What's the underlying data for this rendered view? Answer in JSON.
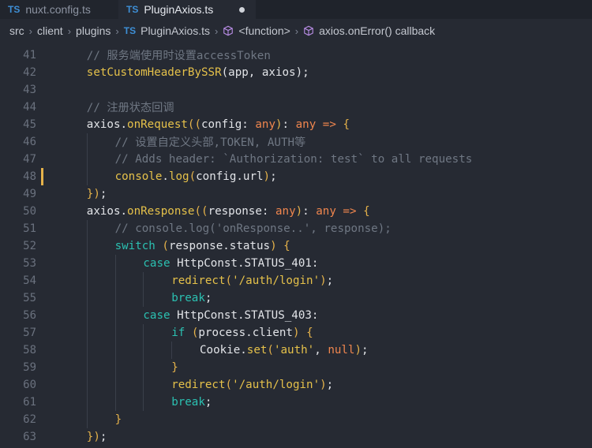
{
  "tabs": [
    {
      "badge": "TS",
      "label": "nuxt.config.ts",
      "active": false
    },
    {
      "badge": "TS",
      "label": "PluginAxios.ts",
      "active": true
    }
  ],
  "breadcrumb": {
    "items": [
      "src",
      "client",
      "plugins"
    ],
    "file_badge": "TS",
    "file": "PluginAxios.ts",
    "symbol1": "<function>",
    "symbol2": "axios.onError() callback"
  },
  "lines": [
    {
      "n": "41",
      "indent": 1,
      "tokens": [
        [
          "cm",
          "// 服务端使用时设置accessToken"
        ]
      ]
    },
    {
      "n": "42",
      "indent": 1,
      "tokens": [
        [
          "fn",
          "setCustomHeaderBySSR"
        ],
        [
          "pr",
          "(app, axios);"
        ]
      ]
    },
    {
      "n": "43",
      "indent": 0,
      "tokens": []
    },
    {
      "n": "44",
      "indent": 1,
      "tokens": [
        [
          "cm",
          "// 注册状态回调"
        ]
      ]
    },
    {
      "n": "45",
      "indent": 1,
      "tokens": [
        [
          "obj",
          "axios."
        ],
        [
          "fn",
          "onRequest"
        ],
        [
          "brk",
          "(("
        ],
        [
          "pr",
          "config: "
        ],
        [
          "typ",
          "any"
        ],
        [
          "brk",
          ")"
        ],
        [
          "pr",
          ": "
        ],
        [
          "typ",
          "any"
        ],
        [
          "pr",
          " "
        ],
        [
          "kw",
          "=>"
        ],
        [
          "pr",
          " "
        ],
        [
          "brk",
          "{"
        ]
      ]
    },
    {
      "n": "46",
      "indent": 2,
      "tokens": [
        [
          "cm",
          "// 设置自定义头部,TOKEN, AUTH等"
        ]
      ]
    },
    {
      "n": "47",
      "indent": 2,
      "tokens": [
        [
          "cm",
          "// Adds header: `Authorization: test` to all requests"
        ]
      ]
    },
    {
      "n": "48",
      "indent": 2,
      "tokens": [
        [
          "fn",
          "console"
        ],
        [
          "pr",
          "."
        ],
        [
          "fn",
          "log"
        ],
        [
          "brk",
          "("
        ],
        [
          "pr",
          "config.url"
        ],
        [
          "brk",
          ")"
        ],
        [
          "pr",
          ";"
        ]
      ]
    },
    {
      "n": "49",
      "indent": 1,
      "tokens": [
        [
          "brk",
          "})"
        ],
        [
          "pr",
          ";"
        ]
      ]
    },
    {
      "n": "50",
      "indent": 1,
      "tokens": [
        [
          "obj",
          "axios."
        ],
        [
          "fn",
          "onResponse"
        ],
        [
          "brk",
          "(("
        ],
        [
          "pr",
          "response: "
        ],
        [
          "typ",
          "any"
        ],
        [
          "brk",
          ")"
        ],
        [
          "pr",
          ": "
        ],
        [
          "typ",
          "any"
        ],
        [
          "pr",
          " "
        ],
        [
          "kw",
          "=>"
        ],
        [
          "pr",
          " "
        ],
        [
          "brk",
          "{"
        ]
      ]
    },
    {
      "n": "51",
      "indent": 2,
      "tokens": [
        [
          "cm",
          "// console.log('onResponse..', response);"
        ]
      ]
    },
    {
      "n": "52",
      "indent": 2,
      "tokens": [
        [
          "kw2",
          "switch"
        ],
        [
          "pr",
          " "
        ],
        [
          "brk",
          "("
        ],
        [
          "pr",
          "response.status"
        ],
        [
          "brk",
          ")"
        ],
        [
          "pr",
          " "
        ],
        [
          "brk",
          "{"
        ]
      ]
    },
    {
      "n": "53",
      "indent": 3,
      "tokens": [
        [
          "kw2",
          "case"
        ],
        [
          "pr",
          " HttpConst.STATUS_401:"
        ]
      ]
    },
    {
      "n": "54",
      "indent": 4,
      "tokens": [
        [
          "fn",
          "redirect"
        ],
        [
          "brk",
          "("
        ],
        [
          "str",
          "'/auth/login'"
        ],
        [
          "brk",
          ")"
        ],
        [
          "pr",
          ";"
        ]
      ]
    },
    {
      "n": "55",
      "indent": 4,
      "tokens": [
        [
          "kw2",
          "break"
        ],
        [
          "pr",
          ";"
        ]
      ]
    },
    {
      "n": "56",
      "indent": 3,
      "tokens": [
        [
          "kw2",
          "case"
        ],
        [
          "pr",
          " HttpConst.STATUS_403:"
        ]
      ]
    },
    {
      "n": "57",
      "indent": 4,
      "tokens": [
        [
          "kw2",
          "if"
        ],
        [
          "pr",
          " "
        ],
        [
          "brk",
          "("
        ],
        [
          "pr",
          "process.client"
        ],
        [
          "brk",
          ")"
        ],
        [
          "pr",
          " "
        ],
        [
          "brk",
          "{"
        ]
      ]
    },
    {
      "n": "58",
      "indent": 5,
      "tokens": [
        [
          "pr",
          "Cookie."
        ],
        [
          "fn",
          "set"
        ],
        [
          "brk",
          "("
        ],
        [
          "str",
          "'auth'"
        ],
        [
          "pr",
          ", "
        ],
        [
          "typ",
          "null"
        ],
        [
          "brk",
          ")"
        ],
        [
          "pr",
          ";"
        ]
      ]
    },
    {
      "n": "59",
      "indent": 4,
      "tokens": [
        [
          "brk",
          "}"
        ]
      ]
    },
    {
      "n": "60",
      "indent": 4,
      "tokens": [
        [
          "fn",
          "redirect"
        ],
        [
          "brk",
          "("
        ],
        [
          "str",
          "'/auth/login'"
        ],
        [
          "brk",
          ")"
        ],
        [
          "pr",
          ";"
        ]
      ]
    },
    {
      "n": "61",
      "indent": 4,
      "tokens": [
        [
          "kw2",
          "break"
        ],
        [
          "pr",
          ";"
        ]
      ]
    },
    {
      "n": "62",
      "indent": 2,
      "tokens": [
        [
          "brk",
          "}"
        ]
      ]
    },
    {
      "n": "63",
      "indent": 1,
      "tokens": [
        [
          "brk",
          "})"
        ],
        [
          "pr",
          ";"
        ]
      ]
    }
  ],
  "modified_line": "48",
  "colors": {
    "background": "#262a33",
    "comment": "#6f7783",
    "function": "#e5c14a",
    "keyword": "#f0864e",
    "control": "#2bc0b1",
    "ts_badge": "#3e8fd6",
    "modified_marker": "#e5b24a"
  }
}
